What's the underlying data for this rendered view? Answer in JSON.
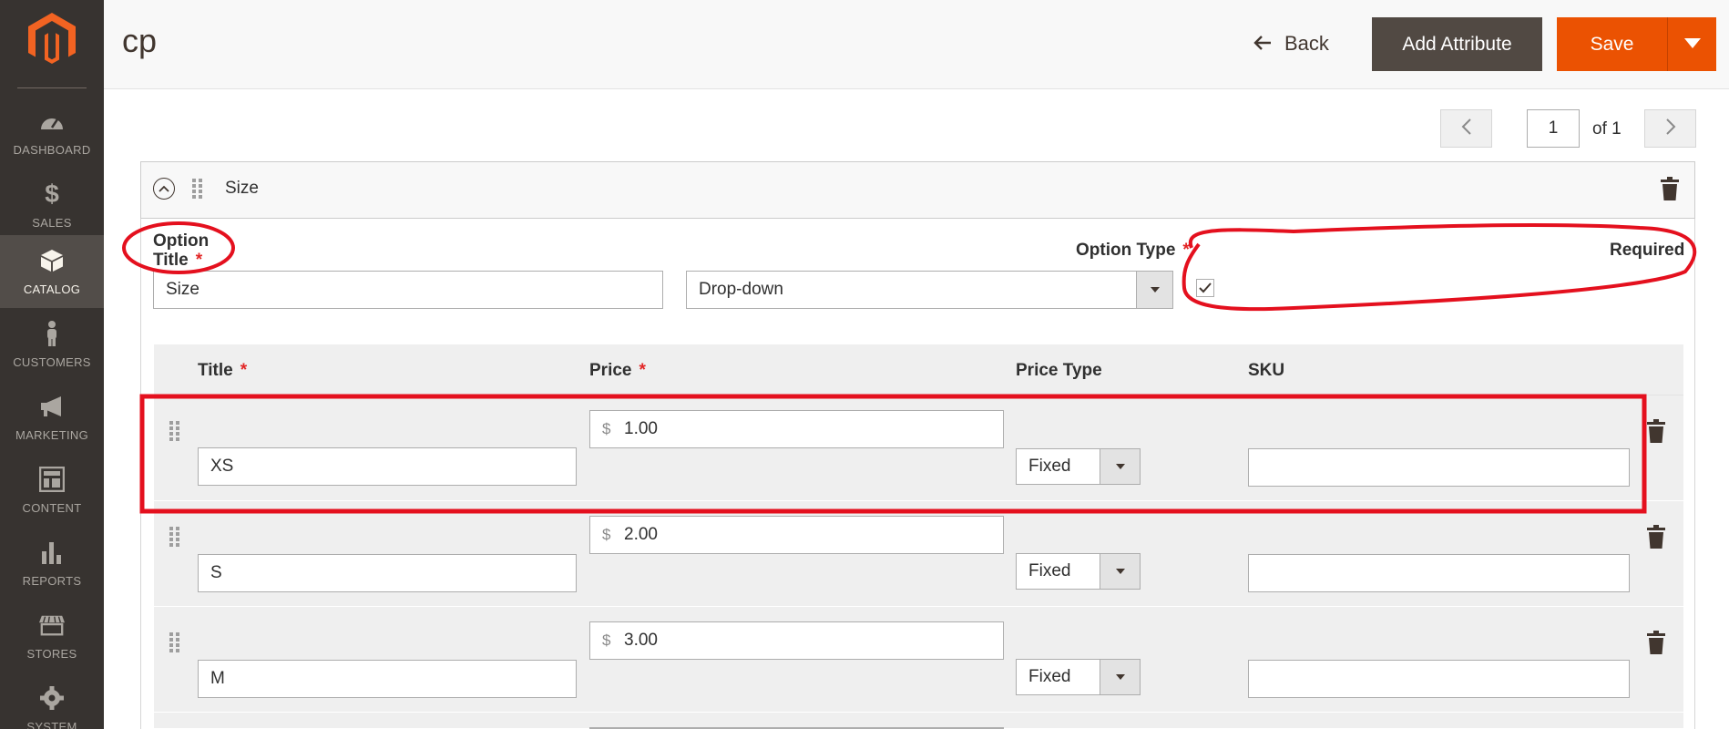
{
  "sidebar": {
    "logo": "magento-logo-icon",
    "items": [
      {
        "label": "DASHBOARD",
        "icon": "dashboard-icon"
      },
      {
        "label": "SALES",
        "icon": "dollar-icon"
      },
      {
        "label": "CATALOG",
        "icon": "cube-icon",
        "active": true
      },
      {
        "label": "CUSTOMERS",
        "icon": "person-icon"
      },
      {
        "label": "MARKETING",
        "icon": "megaphone-icon"
      },
      {
        "label": "CONTENT",
        "icon": "layout-icon"
      },
      {
        "label": "REPORTS",
        "icon": "bar-chart-icon"
      },
      {
        "label": "STORES",
        "icon": "storefront-icon"
      },
      {
        "label": "SYSTEM",
        "icon": "gear-icon"
      }
    ]
  },
  "header": {
    "title": "cp",
    "back_label": "Back",
    "add_attribute_label": "Add Attribute",
    "save_label": "Save"
  },
  "pager": {
    "current": "1",
    "of_label": "of 1"
  },
  "option": {
    "header_title": "Size",
    "title_label": "Option Title",
    "title_value": "Size",
    "type_label": "Option Type",
    "type_value": "Drop-down",
    "required_label": "Required",
    "required_checked": true
  },
  "grid": {
    "headers": {
      "title": "Title",
      "price": "Price",
      "price_type": "Price Type",
      "sku": "SKU"
    },
    "rows": [
      {
        "title": "XS",
        "currency": "$",
        "price": "1.00",
        "price_type": "Fixed",
        "sku": ""
      },
      {
        "title": "S",
        "currency": "$",
        "price": "2.00",
        "price_type": "Fixed",
        "sku": ""
      },
      {
        "title": "M",
        "currency": "$",
        "price": "3.00",
        "price_type": "Fixed",
        "sku": ""
      }
    ]
  },
  "colors": {
    "sidebar_bg": "#373330",
    "sidebar_active": "#524d49",
    "brand_orange": "#eb5202",
    "secondary_button": "#514943",
    "annotation_red": "#e4101e"
  }
}
